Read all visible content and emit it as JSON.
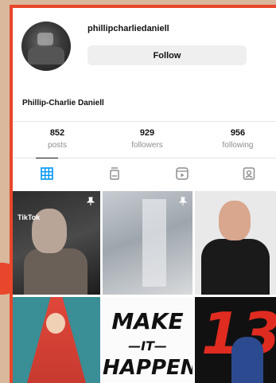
{
  "profile": {
    "username": "phillipcharliedaniell",
    "follow_label": "Follow",
    "full_name": "Phillip-Charlie Daniell"
  },
  "stats": [
    {
      "value": "852",
      "label": "posts"
    },
    {
      "value": "929",
      "label": "followers"
    },
    {
      "value": "956",
      "label": "following"
    }
  ],
  "tabs": [
    {
      "icon": "grid-icon",
      "active": true
    },
    {
      "icon": "reels-icon",
      "active": false
    },
    {
      "icon": "video-icon",
      "active": false
    },
    {
      "icon": "tagged-icon",
      "active": false
    }
  ],
  "posts": [
    {
      "pinned": true,
      "source_badge": "TikTok"
    },
    {
      "pinned": true
    },
    {
      "pinned": false
    },
    {
      "pinned": false
    },
    {
      "pinned": false,
      "text_lines": [
        "MAKE",
        "—IT—",
        "HAPPEN!"
      ]
    },
    {
      "pinned": false,
      "jersey_number": "13"
    }
  ],
  "colors": {
    "frame": "#e8472b",
    "accent_tab": "#0095f6"
  }
}
